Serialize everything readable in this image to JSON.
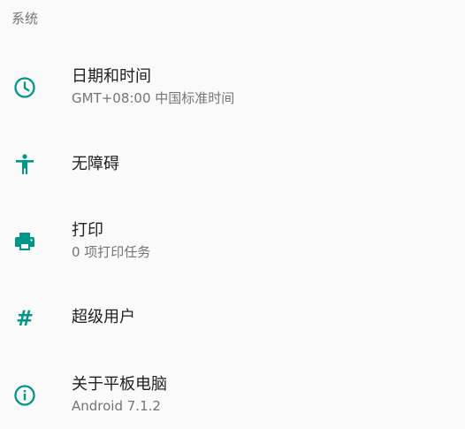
{
  "section": {
    "title": "系统"
  },
  "items": [
    {
      "title": "日期和时间",
      "summary": "GMT+08:00 中国标准时间",
      "icon": "clock-icon"
    },
    {
      "title": "无障碍",
      "icon": "accessibility-icon"
    },
    {
      "title": "打印",
      "summary": "0 项打印任务",
      "icon": "print-icon"
    },
    {
      "title": "超级用户",
      "icon": "hash-icon",
      "icon_glyph": "#"
    },
    {
      "title": "关于平板电脑",
      "summary": "Android 7.1.2",
      "icon": "info-icon"
    }
  ],
  "colors": {
    "accent": "#009688",
    "title_text": "#212121",
    "summary_text": "#757575",
    "background": "#fafafa"
  }
}
